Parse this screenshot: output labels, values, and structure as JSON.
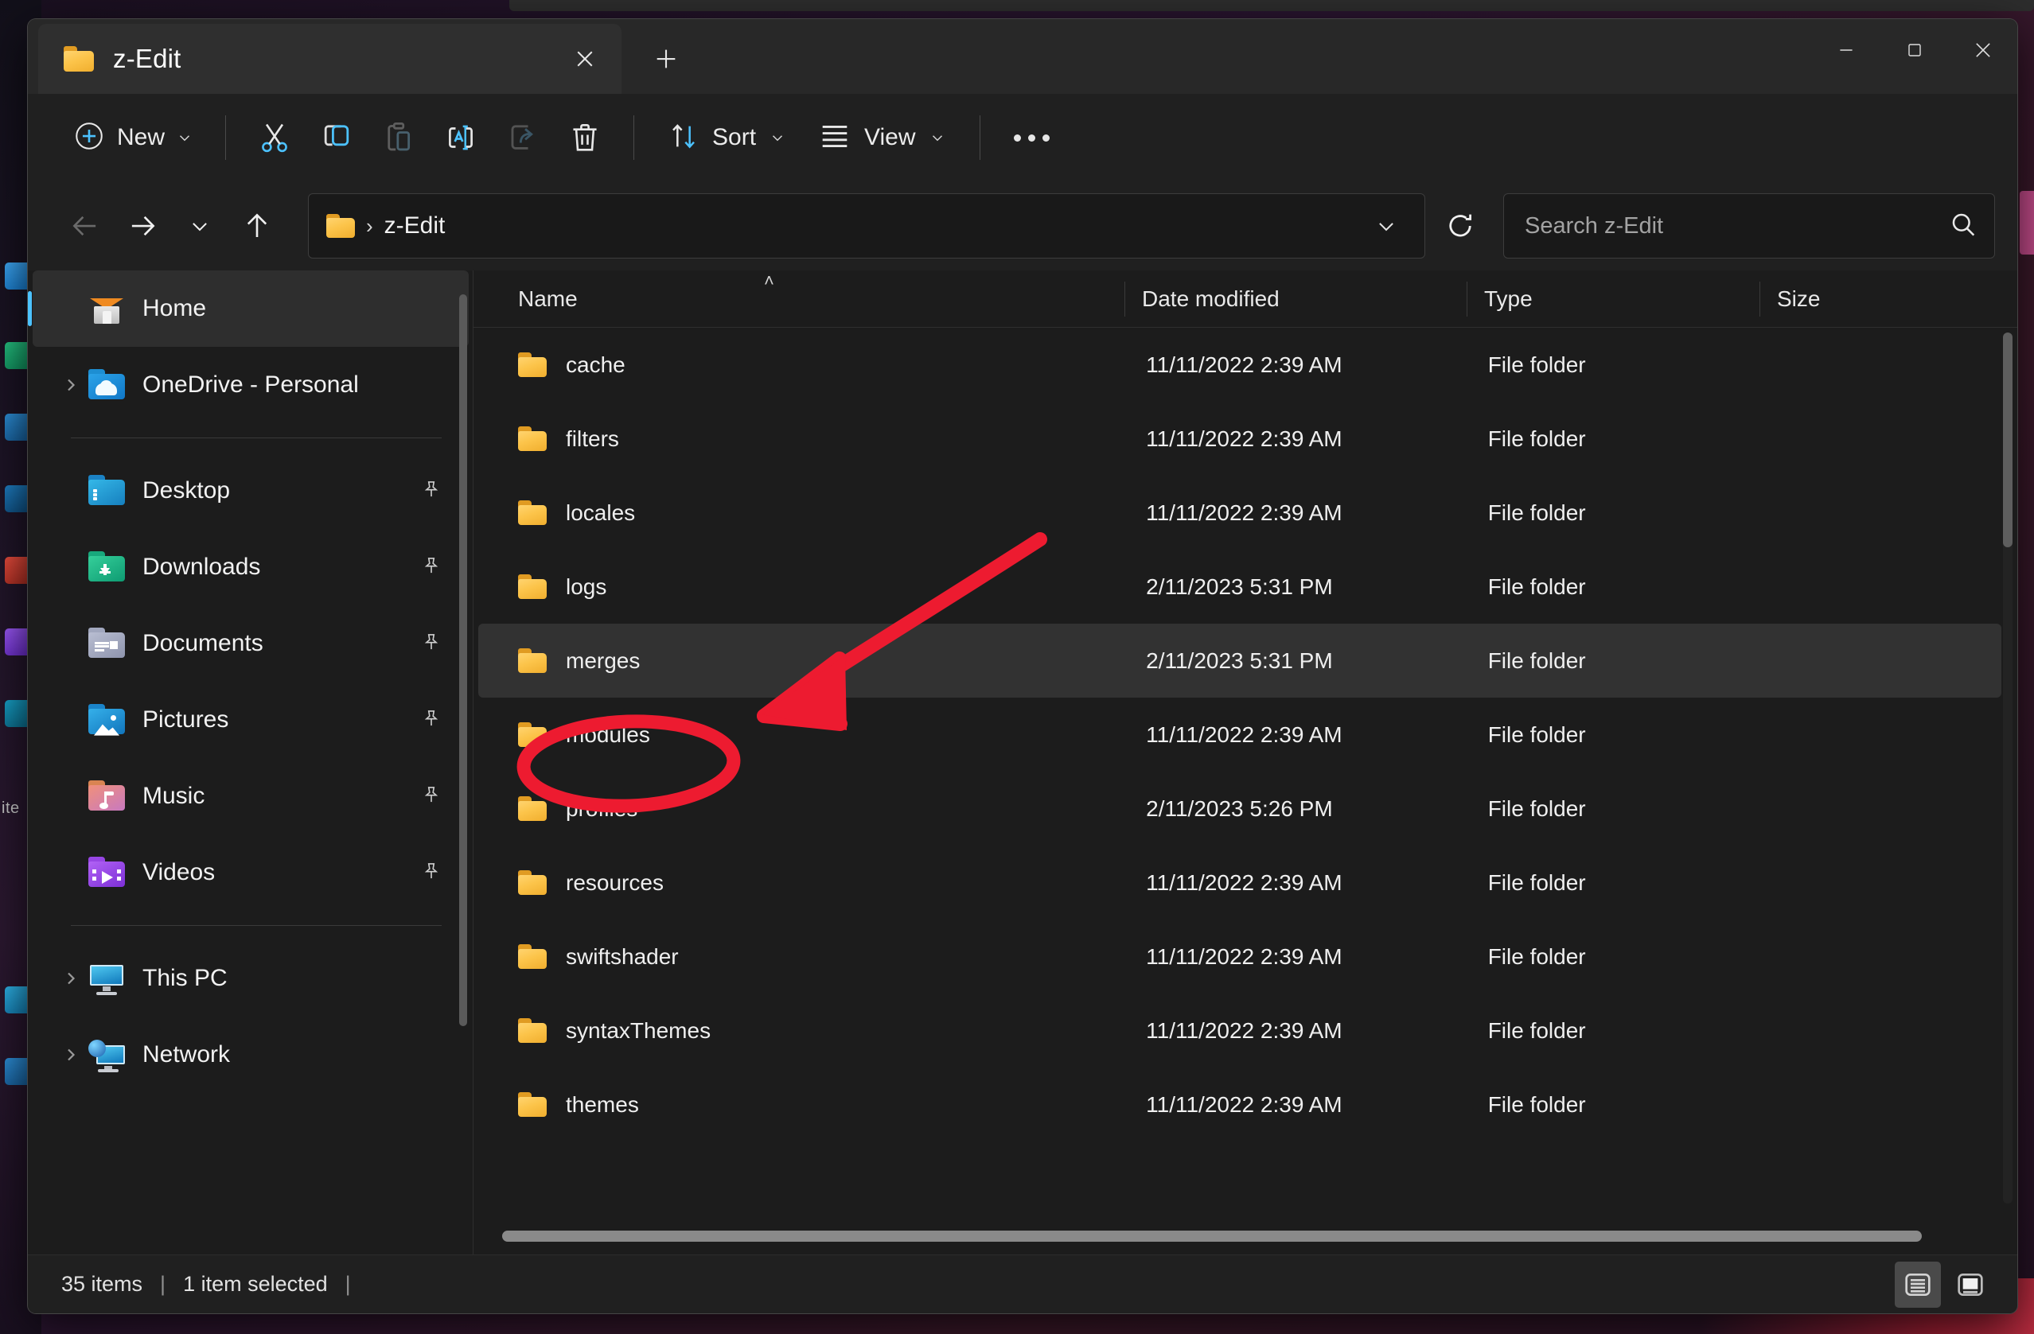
{
  "window": {
    "tab_title": "z-Edit",
    "tab_close_icon": "close-icon",
    "new_tab_icon": "plus-icon",
    "minimize_icon": "minimize-icon",
    "maximize_icon": "maximize-icon",
    "close_icon": "close-icon"
  },
  "toolbar": {
    "new_label": "New",
    "new_icon": "plus-circle-icon",
    "cut_icon": "scissors-icon",
    "copy_icon": "copy-icon",
    "paste_icon": "paste-icon",
    "rename_icon": "rename-icon",
    "share_icon": "share-icon",
    "delete_icon": "trash-icon",
    "sort_label": "Sort",
    "sort_icon": "sort-arrows-icon",
    "view_label": "View",
    "view_icon": "list-lines-icon",
    "more_label": "See more",
    "more_icon": "ellipsis-icon"
  },
  "navbar": {
    "back_icon": "arrow-left-icon",
    "forward_icon": "arrow-right-icon",
    "recent_icon": "chevron-down-icon",
    "up_icon": "arrow-up-icon",
    "breadcrumb_folder_icon": "folder-icon",
    "breadcrumb_separator": "›",
    "breadcrumb_name": "z-Edit",
    "path_dropdown_icon": "chevron-down-icon",
    "refresh_icon": "refresh-icon"
  },
  "search": {
    "placeholder": "Search z-Edit",
    "value": "",
    "icon": "search-icon"
  },
  "sidebar": {
    "items": [
      {
        "label": "Home",
        "icon": "home-icon",
        "expandable": false,
        "selected": true,
        "pinned": false
      },
      {
        "label": "OneDrive - Personal",
        "icon": "onedrive-folder-icon",
        "expandable": true,
        "selected": false,
        "pinned": false
      },
      {
        "label": "Desktop",
        "icon": "desktop-folder-icon",
        "expandable": false,
        "selected": false,
        "pinned": true
      },
      {
        "label": "Downloads",
        "icon": "downloads-folder-icon",
        "expandable": false,
        "selected": false,
        "pinned": true
      },
      {
        "label": "Documents",
        "icon": "documents-folder-icon",
        "expandable": false,
        "selected": false,
        "pinned": true
      },
      {
        "label": "Pictures",
        "icon": "pictures-folder-icon",
        "expandable": false,
        "selected": false,
        "pinned": true
      },
      {
        "label": "Music",
        "icon": "music-folder-icon",
        "expandable": false,
        "selected": false,
        "pinned": true
      },
      {
        "label": "Videos",
        "icon": "videos-folder-icon",
        "expandable": false,
        "selected": false,
        "pinned": true
      },
      {
        "label": "This PC",
        "icon": "this-pc-icon",
        "expandable": true,
        "selected": false,
        "pinned": false
      },
      {
        "label": "Network",
        "icon": "network-icon",
        "expandable": true,
        "selected": false,
        "pinned": false
      }
    ],
    "pin_icon": "pin-icon"
  },
  "filelist": {
    "columns": [
      {
        "label": "Name",
        "sorted": "asc"
      },
      {
        "label": "Date modified",
        "sorted": ""
      },
      {
        "label": "Type",
        "sorted": ""
      },
      {
        "label": "Size",
        "sorted": ""
      }
    ],
    "sort_caret": "˄",
    "rows": [
      {
        "name": "cache",
        "date": "11/11/2022 2:39 AM",
        "type": "File folder",
        "size": "",
        "selected": false
      },
      {
        "name": "filters",
        "date": "11/11/2022 2:39 AM",
        "type": "File folder",
        "size": "",
        "selected": false
      },
      {
        "name": "locales",
        "date": "11/11/2022 2:39 AM",
        "type": "File folder",
        "size": "",
        "selected": false
      },
      {
        "name": "logs",
        "date": "2/11/2023 5:31 PM",
        "type": "File folder",
        "size": "",
        "selected": false
      },
      {
        "name": "merges",
        "date": "2/11/2023 5:31 PM",
        "type": "File folder",
        "size": "",
        "selected": true
      },
      {
        "name": "modules",
        "date": "11/11/2022 2:39 AM",
        "type": "File folder",
        "size": "",
        "selected": false
      },
      {
        "name": "profiles",
        "date": "2/11/2023 5:26 PM",
        "type": "File folder",
        "size": "",
        "selected": false
      },
      {
        "name": "resources",
        "date": "11/11/2022 2:39 AM",
        "type": "File folder",
        "size": "",
        "selected": false
      },
      {
        "name": "swiftshader",
        "date": "11/11/2022 2:39 AM",
        "type": "File folder",
        "size": "",
        "selected": false
      },
      {
        "name": "syntaxThemes",
        "date": "11/11/2022 2:39 AM",
        "type": "File folder",
        "size": "",
        "selected": false
      },
      {
        "name": "themes",
        "date": "11/11/2022 2:39 AM",
        "type": "File folder",
        "size": "",
        "selected": false
      }
    ]
  },
  "statusbar": {
    "item_count": "35 items",
    "separator": "|",
    "selection": "1 item selected",
    "trailing_separator": "|",
    "details_view_icon": "details-view-icon",
    "large_icons_view_icon": "large-icons-view-icon"
  },
  "annotation": {
    "color": "#ed1b30",
    "arrow_icon": "red-arrow-annotation",
    "circle_icon": "red-circle-annotation",
    "target_row": "merges"
  },
  "desktop": {
    "edge_label": "ite"
  }
}
